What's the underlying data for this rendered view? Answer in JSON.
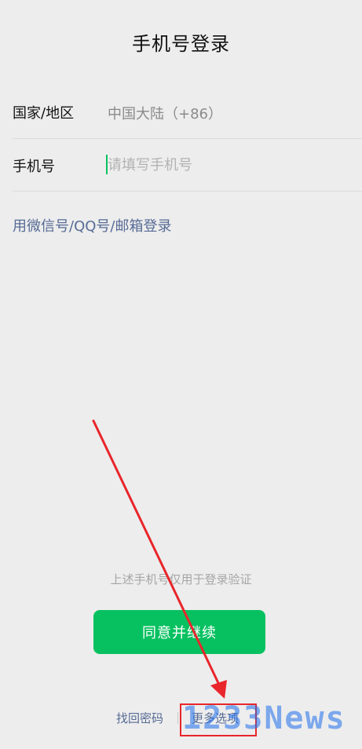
{
  "header": {
    "title": "手机号登录"
  },
  "form": {
    "country_label": "国家/地区",
    "country_value": "中国大陆（+86）",
    "phone_label": "手机号",
    "phone_placeholder": "请填写手机号",
    "phone_value": ""
  },
  "alt_login": {
    "label": "用微信号/QQ号/邮箱登录"
  },
  "footer": {
    "notice": "上述手机号仅用于登录验证",
    "agree_button": "同意并继续",
    "find_password": "找回密码",
    "more_options": "更多选项"
  },
  "annotation": {
    "highlight_color": "#e8262b",
    "arrow_color": "#e8262b",
    "watermark": "1233News"
  },
  "colors": {
    "accent": "#07c160",
    "link": "#576b95",
    "background": "#ededed"
  }
}
